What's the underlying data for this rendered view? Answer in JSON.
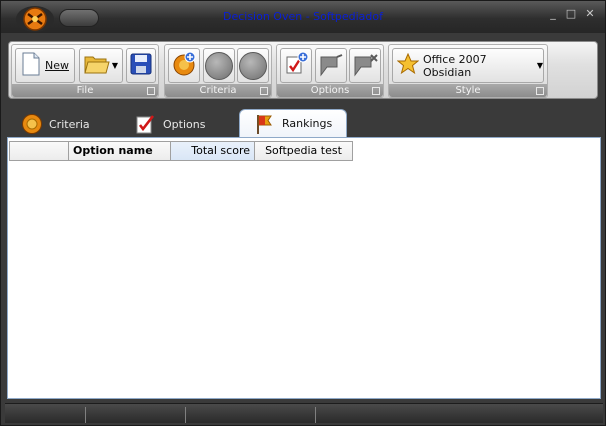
{
  "window": {
    "title": "Decision Oven - Softpediadof",
    "minimize": "_",
    "maximize": "□",
    "close": "✕"
  },
  "ribbon": {
    "groups": [
      {
        "label": "File"
      },
      {
        "label": "Criteria"
      },
      {
        "label": "Options"
      },
      {
        "label": "Style"
      }
    ],
    "file": {
      "new_label": "New"
    },
    "style": {
      "theme_label": "Office 2007 Obsidian"
    }
  },
  "tabs": [
    {
      "label": "Criteria"
    },
    {
      "label": "Options"
    },
    {
      "label": "Rankings"
    }
  ],
  "grid": {
    "columns": [
      "",
      "Option name",
      "Total score",
      "Softpedia test"
    ]
  },
  "colors": {
    "accent": "#0a1fd6",
    "panel_border": "#8fa9c8"
  }
}
